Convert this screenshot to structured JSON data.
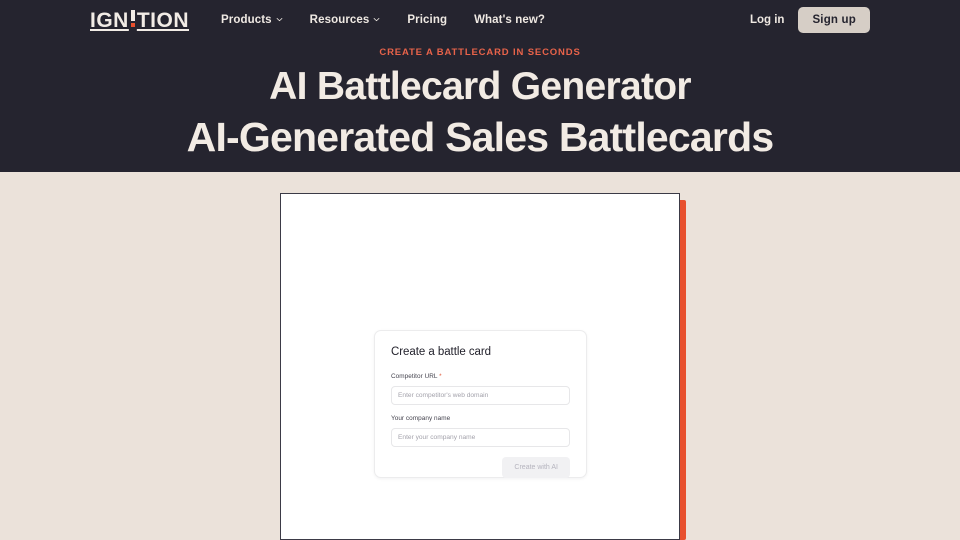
{
  "nav": {
    "logo": {
      "prefix": "IGN",
      "suffix": "TION",
      "accent_color": "#e8502e",
      "full_text": "IGNITION"
    },
    "links": [
      {
        "label": "Products",
        "has_chevron": true,
        "icon": "chevron-down-icon"
      },
      {
        "label": "Resources",
        "has_chevron": true,
        "icon": "chevron-down-icon"
      },
      {
        "label": "Pricing",
        "has_chevron": false
      },
      {
        "label": "What's new?",
        "has_chevron": false
      }
    ],
    "login_label": "Log in",
    "signup_label": "Sign up"
  },
  "hero": {
    "eyebrow": "CREATE A BATTLECARD IN SECONDS",
    "title": "AI Battlecard Generator",
    "subtitle": "AI-Generated Sales Battlecards",
    "background_color": "#25242f",
    "text_color": "#f2ebe4",
    "eyebrow_color": "#e8634a"
  },
  "page": {
    "background_color": "#ebe2da",
    "accent_color": "#e8502e"
  },
  "preview": {
    "form": {
      "title": "Create a battle card",
      "fields": [
        {
          "label": "Competitor URL",
          "required": true,
          "required_marker": "*",
          "value": "",
          "placeholder": "Enter competitor's web domain"
        },
        {
          "label": "Your company name",
          "required": false,
          "required_marker": "",
          "value": "",
          "placeholder": "Enter your company name"
        }
      ],
      "submit_label": "Create with AI",
      "submit_disabled": true
    }
  }
}
